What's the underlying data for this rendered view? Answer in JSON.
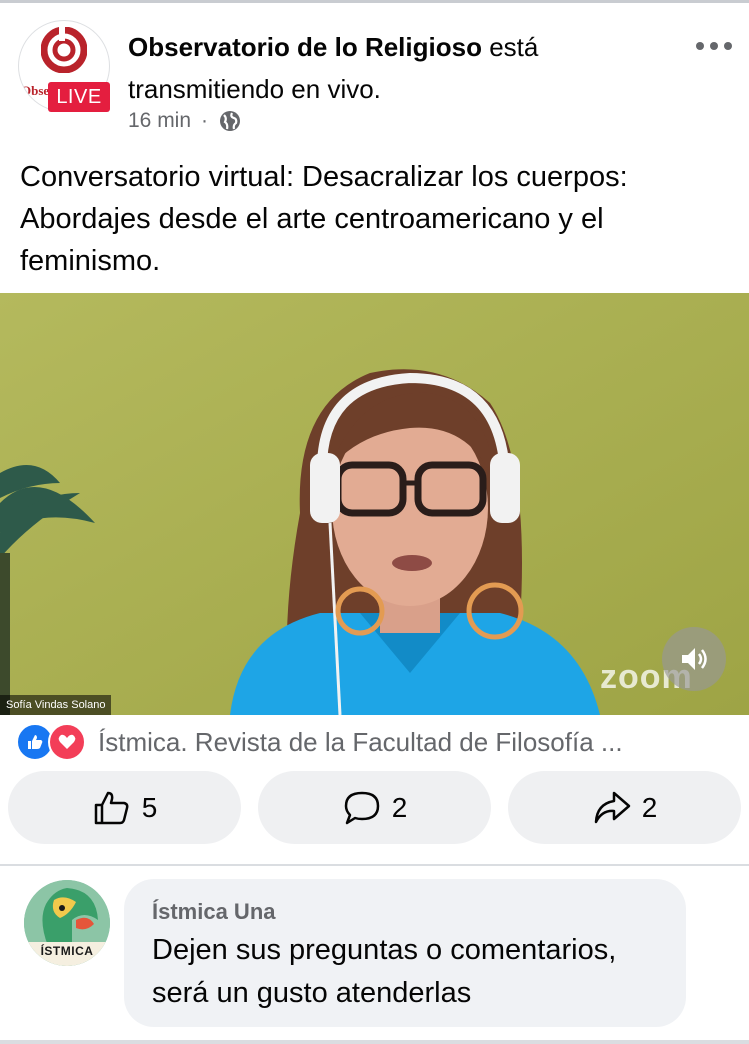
{
  "post": {
    "page_name": "Observatorio de lo Religioso",
    "action_text": " está transmitiendo en vivo.",
    "live_badge": "LIVE",
    "time": "16 min",
    "separator": "·",
    "audience_icon": "globe-icon",
    "more_icon": "more-options-icon",
    "text": "Conversatorio virtual: Desacralizar los cuerpos: Abordajes desde el arte centroamericano y el feminismo.",
    "avatar_fragment": "Obse"
  },
  "video": {
    "speaker_name": "Sofía Vindas Solano",
    "watermark": "zoom",
    "sound_icon": "speaker-icon"
  },
  "reactions": {
    "icons": [
      "like-icon",
      "love-icon"
    ],
    "summary": "Ístmica. Revista de la Facultad de Filosofía ..."
  },
  "actions": {
    "like_count": "5",
    "comment_count": "2",
    "share_count": "2"
  },
  "comment": {
    "author": "Ístmica Una",
    "text": "Dejen sus preguntas o comentarios, será un gusto atenderlas",
    "avatar_label": "ÍSTMICA"
  },
  "colors": {
    "live_red": "#e41e3f",
    "like_blue": "#1877f2",
    "love_red": "#f33e58",
    "meta_gray": "#65676b",
    "wall_green": "#a8ae4e",
    "shirt_blue": "#1ea5e6"
  }
}
